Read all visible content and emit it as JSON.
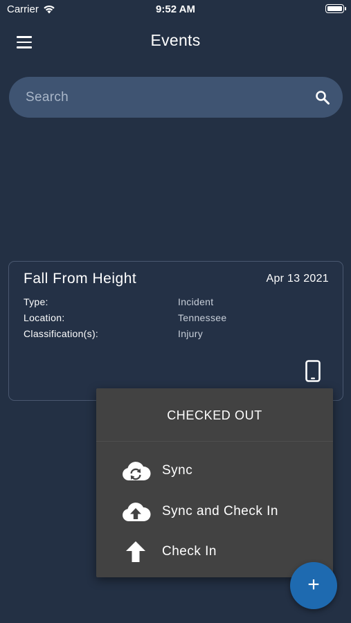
{
  "status_bar": {
    "carrier": "Carrier",
    "time": "9:52 AM"
  },
  "header": {
    "title": "Events",
    "menu_icon": "hamburger-menu-icon"
  },
  "search": {
    "placeholder": "Search",
    "icon": "search-icon"
  },
  "event": {
    "title": "Fall From Height",
    "date": "Apr 13 2021",
    "fields": [
      {
        "label": "Type:",
        "value": "Incident"
      },
      {
        "label": "Location:",
        "value": "Tennessee"
      },
      {
        "label": "Classification(s):",
        "value": "Injury"
      }
    ],
    "status_icon": "mobile-device-icon"
  },
  "popup": {
    "header": "CHECKED OUT",
    "items": [
      {
        "label": "Sync",
        "icon": "cloud-sync-icon"
      },
      {
        "label": "Sync and Check In",
        "icon": "cloud-upload-icon"
      },
      {
        "label": "Check In",
        "icon": "arrow-up-icon"
      }
    ]
  },
  "fab": {
    "symbol": "+",
    "icon": "plus-icon"
  },
  "colors": {
    "background": "#233044",
    "search_bar": "#3f5472",
    "card_border": "#4a5870",
    "popup": "#424242",
    "fab": "#1e6ab0"
  }
}
